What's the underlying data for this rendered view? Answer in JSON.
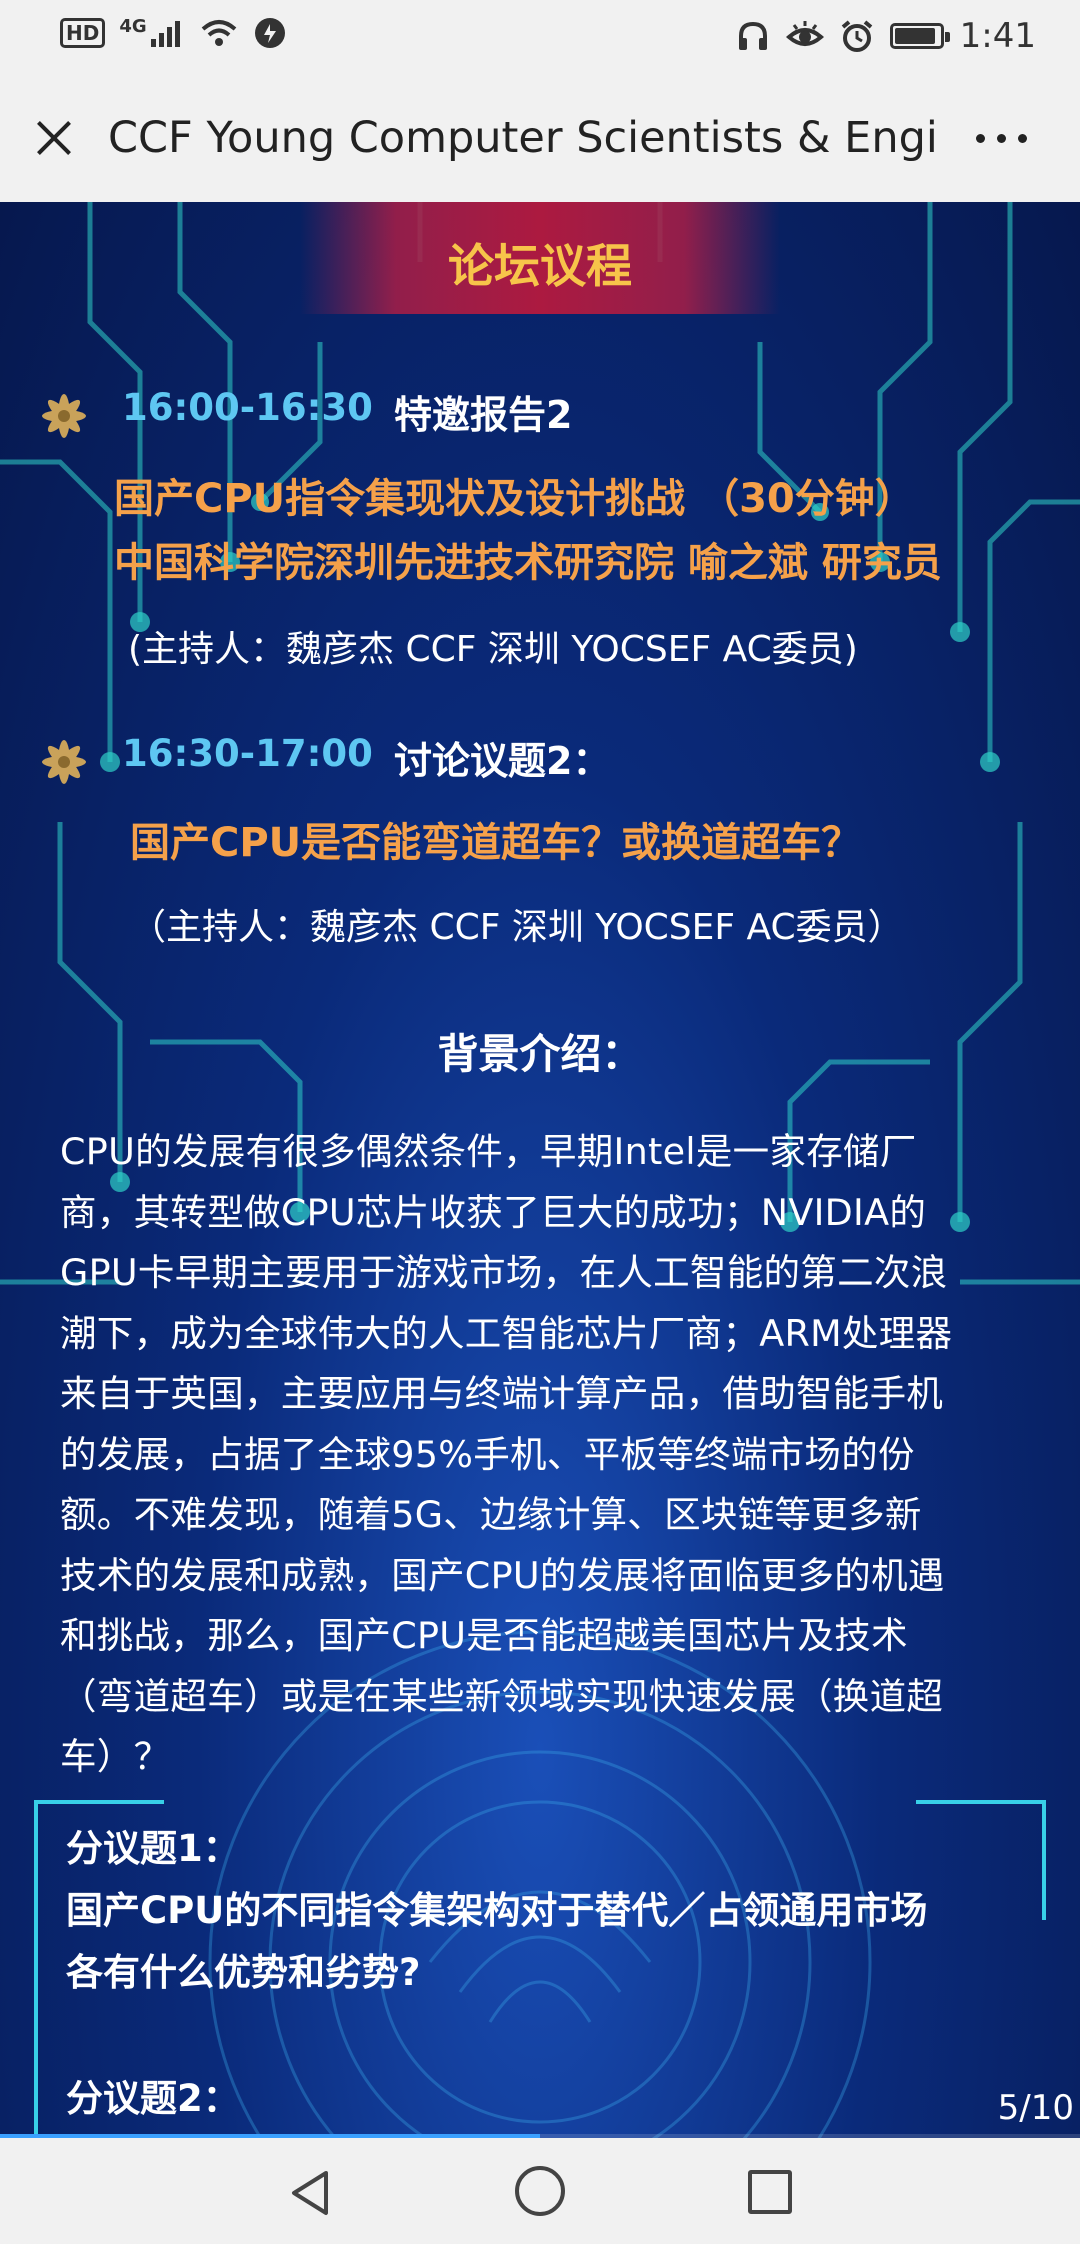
{
  "status_bar": {
    "hd": "HD",
    "network": "4G",
    "time": "1:41",
    "battery_level": 0.92
  },
  "title_bar": {
    "title": "CCF Young Computer Scientists & Engi..."
  },
  "content": {
    "header_title": "论坛议程",
    "sessions": [
      {
        "time": "16:00-16:30",
        "label": "特邀报告2",
        "lines": [
          "国产CPU指令集现状及设计挑战 （30分钟）",
          "中国科学院深圳先进技术研究院  喻之斌  研究员"
        ],
        "host": "(主持人：魏彦杰 CCF 深圳 YOCSEF AC委员)"
      },
      {
        "time": "16:30-17:00",
        "label": "讨论议题2：",
        "lines": [
          "国产CPU是否能弯道超车？或换道超车？"
        ],
        "host": "（主持人：魏彦杰  CCF 深圳 YOCSEF AC委员）"
      }
    ],
    "background_heading": "背景介绍：",
    "background_lines": [
      "CPU的发展有很多偶然条件，早期Intel是一家存储厂",
      "商，其转型做CPU芯片收获了巨大的成功；NVIDIA的",
      "GPU卡早期主要用于游戏市场，在人工智能的第二次浪",
      "潮下，成为全球伟大的人工智能芯片厂商；ARM处理器",
      "来自于英国，主要应用与终端计算产品，借助智能手机",
      "的发展，占据了全球95%手机、平板等终端市场的份",
      "额。不难发现，随着5G、边缘计算、区块链等更多新",
      "技术的发展和成熟，国产CPU的发展将面临更多的机遇",
      "和挑战，那么，国产CPU是否能超越美国芯片及技术",
      "（弯道超车）或是在某些新领域实现快速发展（换道超",
      "车）？"
    ],
    "sub_topics": [
      {
        "title": "分议题1：",
        "lines": [
          "国产CPU的不同指令集架构对于替代／占领通用市场",
          "各有什么优势和劣势?"
        ]
      },
      {
        "title": "分议题2：",
        "lines": []
      }
    ],
    "page_indicator": "5/10",
    "progress": 0.5
  },
  "colors": {
    "accent_time": "#5ec7f2",
    "accent_orange": "#f5a14a",
    "header_gold": "#f7c44a"
  },
  "icons": {
    "close": "close-icon",
    "more": "more-icon",
    "bullet": "flower-icon"
  }
}
